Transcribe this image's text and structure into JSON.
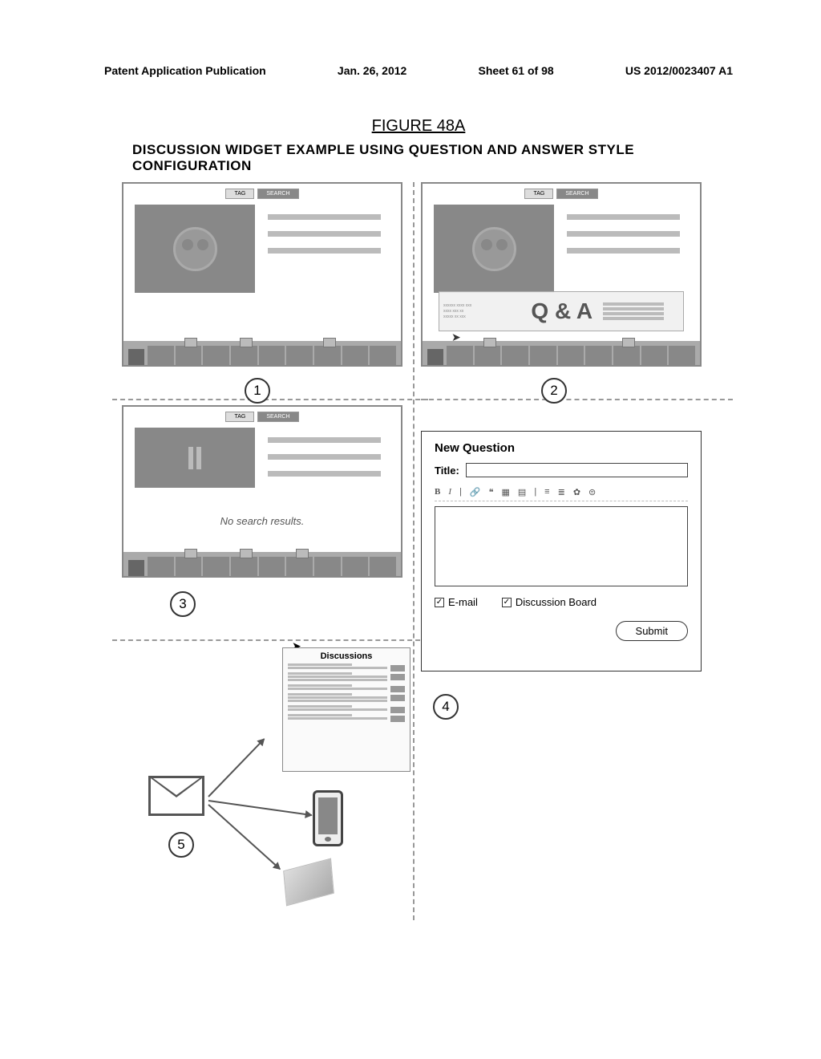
{
  "header": {
    "pub": "Patent Application Publication",
    "date": "Jan. 26, 2012",
    "sheet": "Sheet 61 of 98",
    "pubno": "US 2012/0023407 A1"
  },
  "figure": {
    "title": "FIGURE 48A",
    "subtitle": "DISCUSSION WIDGET EXAMPLE USING QUESTION AND ANSWER STYLE CONFIGURATION"
  },
  "tabs": {
    "left": "TAG",
    "right": "SEARCH"
  },
  "qa": {
    "label": "Q & A"
  },
  "panel3": {
    "no_results": "No search results."
  },
  "panel4": {
    "heading": "New Question",
    "title_label": "Title:",
    "tb": {
      "bold": "B",
      "italic": "I"
    },
    "email": "E-mail",
    "board": "Discussion Board",
    "submit": "Submit"
  },
  "panel5": {
    "discussions": "Discussions"
  },
  "nums": {
    "n1": "1",
    "n2": "2",
    "n3": "3",
    "n4": "4",
    "n5": "5"
  }
}
